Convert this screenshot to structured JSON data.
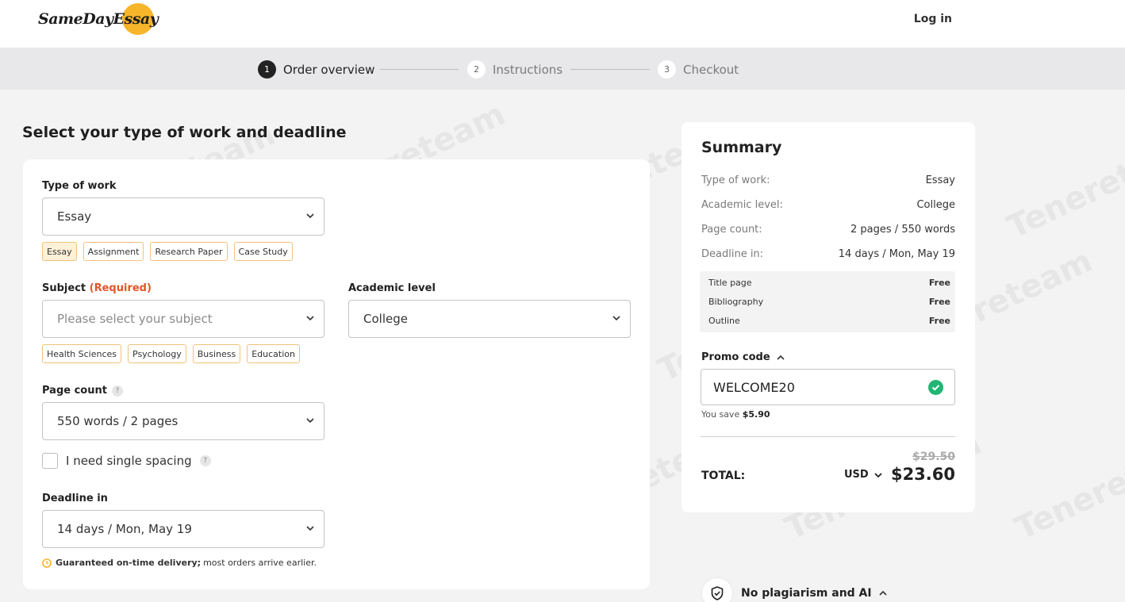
{
  "header": {
    "logo_text": "SameDayEssay",
    "login_label": "Log in"
  },
  "steps": [
    {
      "num": "1",
      "label": "Order overview",
      "active": true
    },
    {
      "num": "2",
      "label": "Instructions",
      "active": false
    },
    {
      "num": "3",
      "label": "Checkout",
      "active": false
    }
  ],
  "form": {
    "title": "Select your type of work and deadline",
    "type_of_work": {
      "label": "Type of work",
      "value": "Essay",
      "chips": [
        "Essay",
        "Assignment",
        "Research Paper",
        "Case Study"
      ],
      "selected_chip": "Essay"
    },
    "subject": {
      "label": "Subject",
      "required_label": "(Required)",
      "placeholder": "Please select your subject",
      "chips": [
        "Health Sciences",
        "Psychology",
        "Business",
        "Education"
      ]
    },
    "academic_level": {
      "label": "Academic level",
      "value": "College"
    },
    "page_count": {
      "label": "Page count",
      "help": "?",
      "value": "550 words / 2 pages"
    },
    "single_spacing": {
      "label": "I need single spacing",
      "help": "?",
      "checked": false
    },
    "deadline": {
      "label": "Deadline in",
      "value": "14 days / Mon, May 19"
    },
    "guarantee": {
      "bold": "Guaranteed on-time delivery;",
      "rest": "most orders arrive earlier."
    }
  },
  "summary": {
    "title": "Summary",
    "rows": [
      {
        "key": "Type of work:",
        "value": "Essay"
      },
      {
        "key": "Academic level:",
        "value": "College"
      },
      {
        "key": "Page count:",
        "value": "2 pages / 550 words"
      },
      {
        "key": "Deadline in:",
        "value": "14 days / Mon, May 19"
      }
    ],
    "extras": [
      {
        "name": "Title page",
        "price": "Free"
      },
      {
        "name": "Bibliography",
        "price": "Free"
      },
      {
        "name": "Outline",
        "price": "Free"
      }
    ],
    "promo_label": "Promo code",
    "promo_value": "WELCOME20",
    "save_text": "You save",
    "save_amount": "$5.90",
    "old_price": "$29.50",
    "total_label": "TOTAL:",
    "currency": "USD",
    "total_price": "$23.60"
  },
  "guarantee_item": {
    "label": "No plagiarism and AI"
  },
  "watermark": "Tenereteam",
  "colors": {
    "accent": "#f7b52a",
    "required": "#e2552a",
    "success": "#22b573",
    "chip_border": "#f2c27a"
  }
}
